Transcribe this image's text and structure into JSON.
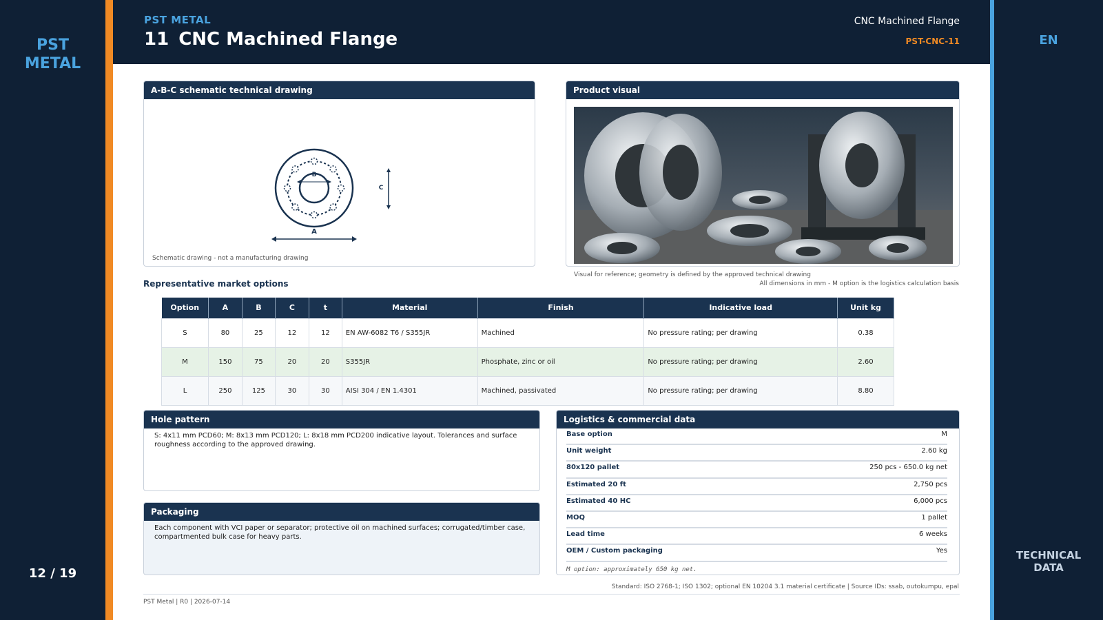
{
  "sidebar": {
    "brand_line1": "PST",
    "brand_line2": "METAL",
    "page_number": "12 / 19"
  },
  "right_rail": {
    "language": "EN",
    "section_line1": "TECHNICAL",
    "section_line2": "DATA"
  },
  "header": {
    "kicker": "PST METAL",
    "number": "11",
    "title": "CNC Machined Flange",
    "product_name": "CNC Machined Flange",
    "product_code": "PST-CNC-11"
  },
  "drawing": {
    "title": "A-B-C schematic technical drawing",
    "label_a": "A",
    "label_b": "B",
    "label_c": "C",
    "note": "Schematic drawing - not a manufacturing drawing"
  },
  "visual": {
    "title": "Product visual",
    "note": "Visual for reference; geometry is defined by the approved technical drawing"
  },
  "dims_note": "All dimensions in mm - M option is the logistics calculation basis",
  "options": {
    "title": "Representative market options",
    "headers": [
      "Option",
      "A",
      "B",
      "C",
      "t",
      "Material",
      "Finish",
      "Indicative load",
      "Unit kg"
    ],
    "rows": [
      [
        "S",
        "80",
        "25",
        "12",
        "12",
        "EN AW-6082 T6 / S355JR",
        "Machined",
        "No pressure rating; per drawing",
        "0.38"
      ],
      [
        "M",
        "150",
        "75",
        "20",
        "20",
        "S355JR",
        "Phosphate, zinc or oil",
        "No pressure rating; per drawing",
        "2.60"
      ],
      [
        "L",
        "250",
        "125",
        "30",
        "30",
        "AISI 304 / EN 1.4301",
        "Machined, passivated",
        "No pressure rating; per drawing",
        "8.80"
      ]
    ]
  },
  "hole_pattern": {
    "title": "Hole pattern",
    "text": "S: 4x11 mm PCD60; M: 8x13 mm PCD120; L: 8x18 mm PCD200 indicative layout. Tolerances and surface roughness according to the approved drawing."
  },
  "packaging": {
    "title": "Packaging",
    "text": "Each component with VCI paper or separator; protective oil on machined surfaces; corrugated/timber case, compartmented bulk case for heavy parts."
  },
  "logistics": {
    "title": "Logistics & commercial data",
    "rows": [
      {
        "k": "Base option",
        "v": "M"
      },
      {
        "k": "Unit weight",
        "v": "2.60 kg"
      },
      {
        "k": "80x120 pallet",
        "v": "250 pcs - 650.0 kg net"
      },
      {
        "k": "Estimated 20 ft",
        "v": "2,750 pcs"
      },
      {
        "k": "Estimated 40 HC",
        "v": "6,000 pcs"
      },
      {
        "k": "MOQ",
        "v": "1 pallet"
      },
      {
        "k": "Lead time",
        "v": "6 weeks"
      },
      {
        "k": "OEM / Custom packaging",
        "v": "Yes"
      }
    ],
    "note": "M option: approximately 650 kg net."
  },
  "standard": "Standard: ISO 2768-1; ISO 1302; optional EN 10204 3.1 material certificate | Source IDs: ssab, outokumpu, epal",
  "footer": "PST Metal | R0 | 2026-07-14",
  "colors": {
    "navy": "#0f2035",
    "panel_head": "#1a3350",
    "accent_orange": "#f08a24",
    "accent_blue": "#4aa3df"
  }
}
